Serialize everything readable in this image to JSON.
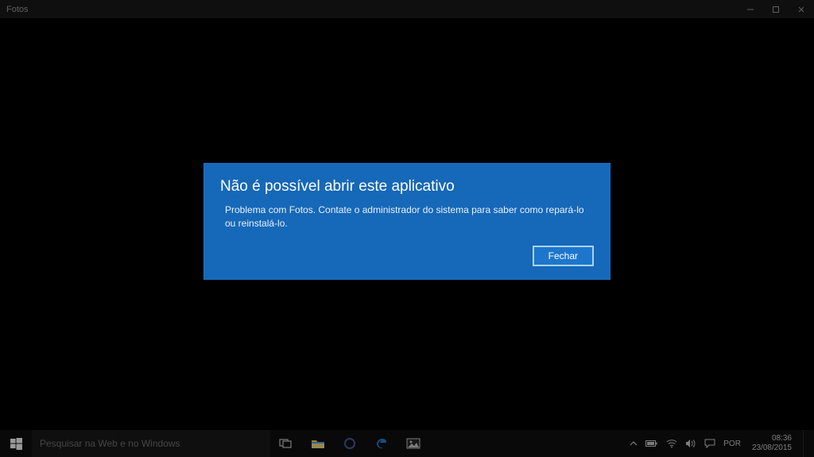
{
  "titlebar": {
    "app_name": "Fotos"
  },
  "modal": {
    "title": "Não é possível abrir este aplicativo",
    "body": "Problema com Fotos. Contate o administrador do sistema para saber como repará-lo ou reinstalá-lo.",
    "close_label": "Fechar"
  },
  "taskbar": {
    "search_placeholder": "Pesquisar na Web e no Windows",
    "language": "POR",
    "time": "08:36",
    "date": "23/08/2015"
  }
}
